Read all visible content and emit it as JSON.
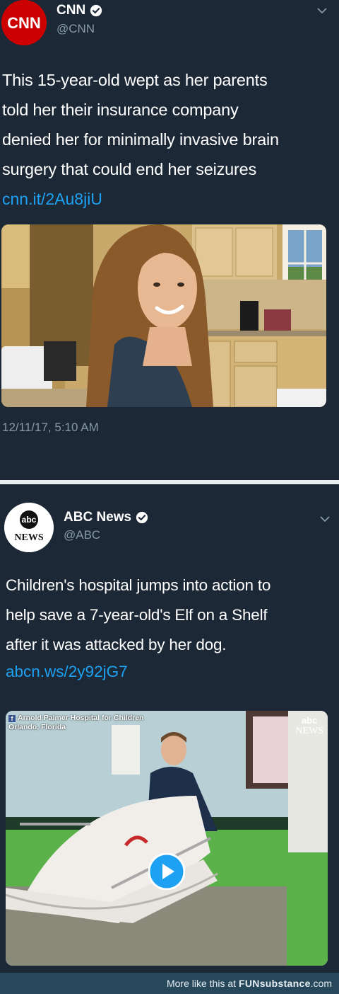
{
  "tweet1": {
    "account_name": "CNN",
    "handle": "@CNN",
    "avatar_text": "CNN",
    "text_lines": [
      "This 15-year-old wept as her parents",
      "told her their insurance company",
      "denied her for minimally invasive brain",
      "surgery that could end her seizures"
    ],
    "link": "cnn.it/2Au8jiU",
    "timestamp": "12/11/17, 5:10 AM"
  },
  "tweet2": {
    "account_name": "ABC News",
    "handle": "@ABC",
    "avatar_top": "abc",
    "avatar_bottom": "NEWS",
    "text_lines": [
      "Children's hospital jumps into action to",
      "help save a 7-year-old's Elf on a Shelf",
      "after it was attacked by her dog."
    ],
    "link": "abcn.ws/2y92jG7",
    "video_source_line1": "Arnold Palmer Hospital for Children",
    "video_source_line2": "Orlando, Florida",
    "video_logo_top": "abc",
    "video_logo_bottom": "NEWS"
  },
  "footer": {
    "prefix": "More like this at ",
    "brand": "FUNsubstance",
    "suffix": ".com"
  },
  "colors": {
    "background": "#1c2836",
    "link": "#1da1f2",
    "secondary_text": "#8899a6",
    "cnn_red": "#cc0000"
  }
}
